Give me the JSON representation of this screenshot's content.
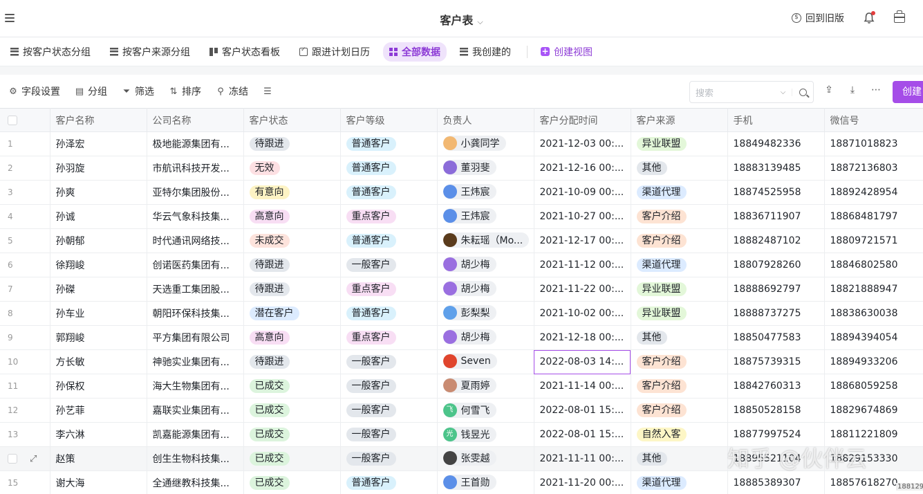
{
  "header": {
    "title": "客户表",
    "old_version": "回到旧版"
  },
  "views": [
    {
      "label": "按客户状态分组",
      "icon": "table-icon"
    },
    {
      "label": "按客户来源分组",
      "icon": "table-icon"
    },
    {
      "label": "客户状态看板",
      "icon": "kanban-icon"
    },
    {
      "label": "跟进计划日历",
      "icon": "calendar-icon"
    },
    {
      "label": "全部数据",
      "icon": "grid-icon",
      "active": true
    },
    {
      "label": "我创建的",
      "icon": "table-icon"
    }
  ],
  "create_view": "创建视图",
  "toolbar": {
    "fields": "字段设置",
    "group": "分组",
    "filter": "筛选",
    "sort": "排序",
    "freeze": "冻结",
    "search_placeholder": "搜索",
    "create": "创建"
  },
  "columns": [
    "客户名称",
    "公司名称",
    "客户状态",
    "客户等级",
    "负责人",
    "客户分配时间",
    "客户来源",
    "手机",
    "微信号"
  ],
  "rows": [
    {
      "idx": "1",
      "name": "孙泽宏",
      "company": "极地能源集团有...",
      "status": "待跟进",
      "level": "普通客户",
      "owner": "小龚同学",
      "time": "2021-12-03 00:...",
      "source": "异业联盟",
      "phone": "18849482336",
      "wechat": "18871018823"
    },
    {
      "idx": "2",
      "name": "孙羽旋",
      "company": "市航讯科技开发...",
      "status": "无效",
      "level": "普通客户",
      "owner": "董羽斐",
      "time": "2021-12-16 00:...",
      "source": "其他",
      "phone": "18883139485",
      "wechat": "18872136803"
    },
    {
      "idx": "3",
      "name": "孙爽",
      "company": "亚特尔集团股份...",
      "status": "有意向",
      "level": "普通客户",
      "owner": "王炜宸",
      "time": "2021-10-09 00:...",
      "source": "渠道代理",
      "phone": "18874525958",
      "wechat": "18892428954"
    },
    {
      "idx": "4",
      "name": "孙诚",
      "company": "华云气象科技集...",
      "status": "高意向",
      "level": "重点客户",
      "owner": "王炜宸",
      "time": "2021-10-27 00:...",
      "source": "客户介绍",
      "phone": "18836711907",
      "wechat": "18868481797"
    },
    {
      "idx": "5",
      "name": "孙朝郁",
      "company": "时代通讯网络技...",
      "status": "未成交",
      "level": "普通客户",
      "owner": "朱耘瑶（Mo...",
      "time": "2021-12-17 00:...",
      "source": "客户介绍",
      "phone": "18882487102",
      "wechat": "18809721571"
    },
    {
      "idx": "6",
      "name": "徐翔峻",
      "company": "创诺医药集团有...",
      "status": "待跟进",
      "level": "一般客户",
      "owner": "胡少梅",
      "time": "2021-11-12 00:...",
      "source": "渠道代理",
      "phone": "18807928260",
      "wechat": "18846802580"
    },
    {
      "idx": "7",
      "name": "孙磔",
      "company": "天选重工集团股...",
      "status": "待跟进",
      "level": "重点客户",
      "owner": "胡少梅",
      "time": "2021-11-22 00:...",
      "source": "异业联盟",
      "phone": "18888692797",
      "wechat": "18821888947"
    },
    {
      "idx": "8",
      "name": "孙车业",
      "company": "朝阳环保科技集...",
      "status": "潜在客户",
      "level": "普通客户",
      "owner": "彭梨梨",
      "time": "2021-10-02 00:...",
      "source": "异业联盟",
      "phone": "18888737275",
      "wechat": "18838630038"
    },
    {
      "idx": "9",
      "name": "郭翔峻",
      "company": "平方集团有限公司",
      "status": "高意向",
      "level": "重点客户",
      "owner": "胡少梅",
      "time": "2021-12-18 00:...",
      "source": "其他",
      "phone": "18850477583",
      "wechat": "18894394054"
    },
    {
      "idx": "10",
      "name": "方长敏",
      "company": "神驰实业集团有...",
      "status": "待跟进",
      "level": "一般客户",
      "owner": "Seven",
      "time": "2022-08-03 14:...",
      "source": "客户介绍",
      "phone": "18875739315",
      "wechat": "18894933206"
    },
    {
      "idx": "11",
      "name": "孙保权",
      "company": "海大生物集团有...",
      "status": "已成交",
      "level": "一般客户",
      "owner": "夏雨婷",
      "time": "2021-11-14 00:...",
      "source": "客户介绍",
      "phone": "18842760313",
      "wechat": "18868059258"
    },
    {
      "idx": "12",
      "name": "孙艺菲",
      "company": "嘉联实业集团有...",
      "status": "已成交",
      "level": "一般客户",
      "owner": "何雪飞",
      "time": "2022-08-01 15:...",
      "source": "客户介绍",
      "phone": "18850528158",
      "wechat": "18829674869"
    },
    {
      "idx": "13",
      "name": "李六淋",
      "company": "凯嘉能源集团有...",
      "status": "已成交",
      "level": "一般客户",
      "owner": "钱昱光",
      "time": "2022-08-01 15:...",
      "source": "自然入客",
      "phone": "18877997524",
      "wechat": "18811221809"
    },
    {
      "idx": "",
      "name": "赵策",
      "company": "创生生物科技集...",
      "status": "已成交",
      "level": "一般客户",
      "owner": "张雯越",
      "time": "2021-11-11 00:...",
      "source": "其他",
      "phone": "18895521104",
      "wechat": "18829153330"
    },
    {
      "idx": "15",
      "name": "谢大海",
      "company": "全通继教科技集...",
      "status": "已成交",
      "level": "普通客户",
      "owner": "王首勋",
      "time": "2021-11-20 00:...",
      "source": "渠道代理",
      "phone": "18885389307",
      "wechat": "18857618270"
    }
  ],
  "status_colors": {
    "待跟进": "#e3e7ec",
    "无效": "#fde0e3",
    "有意向": "#fdf3c4",
    "高意向": "#f8def4",
    "未成交": "#fde3dc",
    "潜在客户": "#dcebff",
    "已成交": "#dcf4dd"
  },
  "level_colors": {
    "普通客户": "#d9f1fc",
    "重点客户": "#f8def4",
    "一般客户": "#e3e7ec"
  },
  "source_colors": {
    "异业联盟": "#e3f7d9",
    "其他": "#e3e7ec",
    "渠道代理": "#dcebff",
    "客户介绍": "#fde3d3",
    "自然入客": "#fdf6c6"
  },
  "avatar_colors": {
    "小龚同学": "#f2b872",
    "董羽斐": "#8b6cd9",
    "王炜宸": "#5b8fe8",
    "朱耘瑶（Mo...": "#5a3b1c",
    "胡少梅": "#9a6fe0",
    "彭梨梨": "#5fa0ea",
    "Seven": "#e0452d",
    "夏雨婷": "#c98b72",
    "何雪飞": "#4cc48a",
    "钱昱光": "#4cc48a",
    "张雯越": "#444444",
    "王首勋": "#5b8fe8"
  },
  "avatar_letters": {
    "何雪飞": "飞",
    "钱昱光": "光"
  },
  "watermark": "知乎 @伙伴云",
  "watermark_small": "188129"
}
